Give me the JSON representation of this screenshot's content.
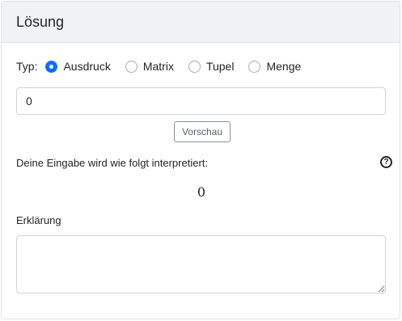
{
  "header": {
    "title": "Lösung"
  },
  "type_row": {
    "label": "Typ:",
    "options": [
      {
        "label": "Ausdruck",
        "checked": true
      },
      {
        "label": "Matrix",
        "checked": false
      },
      {
        "label": "Tupel",
        "checked": false
      },
      {
        "label": "Menge",
        "checked": false
      }
    ]
  },
  "input": {
    "value": "0"
  },
  "preview_button": {
    "label": "Vorschau"
  },
  "interpretation": {
    "label": "Deine Eingabe wird wie folgt interpretiert:",
    "help_icon": "question-circle-icon",
    "help_glyph": "?",
    "value": "0"
  },
  "explanation": {
    "label": "Erklärung",
    "value": ""
  }
}
